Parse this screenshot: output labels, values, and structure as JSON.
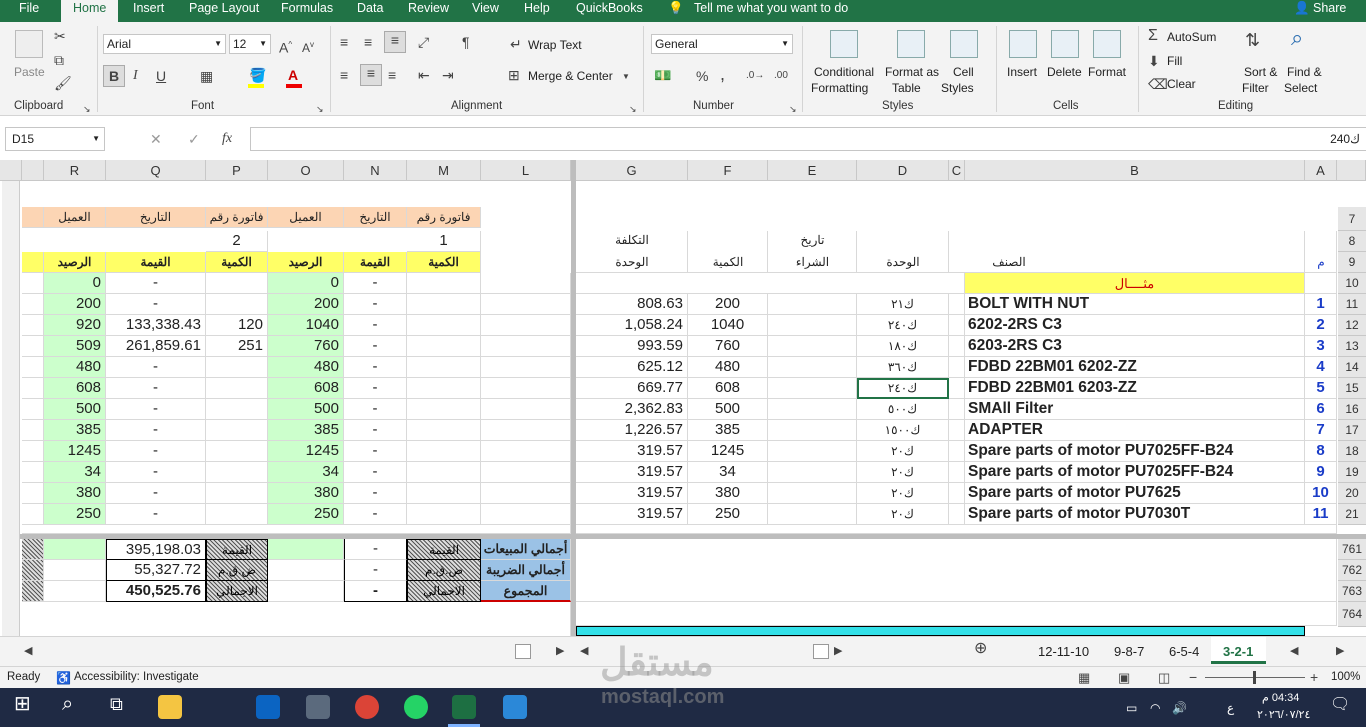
{
  "tabs": [
    "File",
    "Home",
    "Insert",
    "Page Layout",
    "Formulas",
    "Data",
    "Review",
    "View",
    "Help",
    "QuickBooks"
  ],
  "tell_me": "Tell me what you want to do",
  "share": "Share",
  "ribbon": {
    "paste": "Paste",
    "clipboard": "Clipboard",
    "font_name": "Arial",
    "font_size": "12",
    "font": "Font",
    "wrap_text": "Wrap Text",
    "merge_center": "Merge & Center",
    "alignment": "Alignment",
    "number_format": "General",
    "number": "Number",
    "cond_fmt_1": "Conditional",
    "cond_fmt_2": "Formatting",
    "fmt_table_1": "Format as",
    "fmt_table_2": "Table",
    "cell_styles_1": "Cell",
    "cell_styles_2": "Styles",
    "styles": "Styles",
    "insert": "Insert",
    "delete": "Delete",
    "format": "Format",
    "cells": "Cells",
    "autosum": "AutoSum",
    "fill": "Fill",
    "clear": "Clear",
    "sort_1": "Sort &",
    "sort_2": "Filter",
    "find_1": "Find &",
    "find_2": "Select",
    "editing": "Editing",
    "bold": "B",
    "italic": "I",
    "underline": "U",
    "percent": "%",
    "comma": ","
  },
  "formula_bar": {
    "name_box": "D15",
    "value": "ك240",
    "fx": "fx"
  },
  "cols_right": [
    "G",
    "F",
    "E",
    "D",
    "C",
    "B",
    "A"
  ],
  "cols_left": [
    "R",
    "Q",
    "P",
    "O",
    "N",
    "M",
    "L"
  ],
  "rows_right": [
    "7",
    "8",
    "9",
    "10",
    "11",
    "12",
    "13",
    "14",
    "15",
    "16",
    "17",
    "18",
    "19",
    "20",
    "21"
  ],
  "rows_bottom": [
    "761",
    "762",
    "763",
    "764"
  ],
  "headers": {
    "cost_1": "التكلفة",
    "cost_2": "الوحدة",
    "qty": "الكمية",
    "date_1": "تاريخ",
    "date_2": "الشراء",
    "unit": "الوحدة",
    "item": "الصنف",
    "no": "م",
    "example": "مثــــال"
  },
  "items": [
    {
      "n": "1",
      "name": "BOLT WITH NUT",
      "unit": "ك٢١",
      "qty": "200",
      "cost": "808.63"
    },
    {
      "n": "2",
      "name": "6202-2RS C3",
      "unit": "ك٢٤٠",
      "qty": "1040",
      "cost": "1,058.24"
    },
    {
      "n": "3",
      "name": "6203-2RS C3",
      "unit": "ك١٨٠",
      "qty": "760",
      "cost": "993.59"
    },
    {
      "n": "4",
      "name": "FDBD 22BM01 6202-ZZ",
      "unit": "ك٣٦٠",
      "qty": "480",
      "cost": "625.12"
    },
    {
      "n": "5",
      "name": "FDBD 22BM01 6203-ZZ",
      "unit": "ك٢٤٠",
      "qty": "608",
      "cost": "669.77"
    },
    {
      "n": "6",
      "name": "SMAll Filter",
      "unit": "ك٥٠٠",
      "qty": "500",
      "cost": "2,362.83"
    },
    {
      "n": "7",
      "name": "ADAPTER",
      "unit": "ك١٥٠٠",
      "qty": "385",
      "cost": "1,226.57"
    },
    {
      "n": "8",
      "name": "Spare parts of motor PU7025FF-B24",
      "unit": "ك٢٠",
      "qty": "1245",
      "cost": "319.57"
    },
    {
      "n": "9",
      "name": "Spare parts of motor PU7025FF-B24",
      "unit": "ك٢٠",
      "qty": "34",
      "cost": "319.57"
    },
    {
      "n": "10",
      "name": "Spare parts of motor PU7625",
      "unit": "ك٢٠",
      "qty": "380",
      "cost": "319.57"
    },
    {
      "n": "11",
      "name": "Spare parts of motor PU7030T",
      "unit": "ك٢٠",
      "qty": "250",
      "cost": "319.57"
    }
  ],
  "left_headers": {
    "invoice": "فاتورة رقم",
    "date": "التاريخ",
    "client": "العميل",
    "inv1": "1",
    "inv2": "2",
    "qty": "الكمية",
    "value": "القيمة",
    "balance": "الرصيد"
  },
  "left_rows": [
    {
      "r": "0",
      "q": "-",
      "p": "",
      "o": "0",
      "n": "-"
    },
    {
      "r": "200",
      "q": "-",
      "p": "",
      "o": "200",
      "n": "-"
    },
    {
      "r": "920",
      "q": "133,338.43",
      "p": "120",
      "o": "1040",
      "n": "-"
    },
    {
      "r": "509",
      "q": "261,859.61",
      "p": "251",
      "o": "760",
      "n": "-"
    },
    {
      "r": "480",
      "q": "-",
      "p": "",
      "o": "480",
      "n": "-"
    },
    {
      "r": "608",
      "q": "-",
      "p": "",
      "o": "608",
      "n": "-"
    },
    {
      "r": "500",
      "q": "-",
      "p": "",
      "o": "500",
      "n": "-"
    },
    {
      "r": "385",
      "q": "-",
      "p": "",
      "o": "385",
      "n": "-"
    },
    {
      "r": "1245",
      "q": "-",
      "p": "",
      "o": "1245",
      "n": "-"
    },
    {
      "r": "34",
      "q": "-",
      "p": "",
      "o": "34",
      "n": "-"
    },
    {
      "r": "380",
      "q": "-",
      "p": "",
      "o": "380",
      "n": "-"
    },
    {
      "r": "250",
      "q": "-",
      "p": "",
      "o": "250",
      "n": "-"
    }
  ],
  "totals": {
    "sales_label": "أجمالي المبيعات",
    "tax_label": "أجمالي الضريبة",
    "sum_label": "المجموع",
    "value": "القيمة",
    "tax": "ض.ق.م",
    "total": "الاجمالي",
    "q_sales": "395,198.03",
    "q_tax": "55,327.72",
    "q_total": "450,525.76",
    "n1": "-",
    "n2": "-",
    "n3": "-"
  },
  "sheets": [
    "12-11-10",
    "9-8-7",
    "6-5-4",
    "3-2-1"
  ],
  "status": {
    "ready": "Ready",
    "accessibility": "Accessibility: Investigate",
    "zoom": "100%"
  },
  "clock": {
    "time": "04:34 م",
    "date": "٢٠٢٦/٠٧/٢٤",
    "lang": "ع"
  },
  "watermark": {
    "ar": "مستقل",
    "en": "mostaql.com"
  }
}
